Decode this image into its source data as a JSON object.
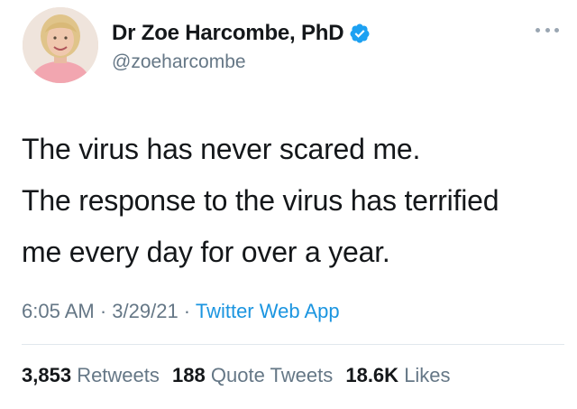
{
  "author": {
    "display_name": "Dr Zoe Harcombe, PhD",
    "handle": "@zoeharcombe",
    "verified": true
  },
  "tweet": {
    "lines": [
      "The virus has never scared me.",
      "The response to the virus has terrified",
      "me every day for over a year."
    ]
  },
  "meta": {
    "time": "6:05 AM",
    "separator": " · ",
    "date": "3/29/21",
    "source": "Twitter Web App"
  },
  "stats": {
    "retweets_count": "3,853",
    "retweets_label": "Retweets",
    "quotes_count": "188",
    "quotes_label": "Quote Tweets",
    "likes_count": "18.6K",
    "likes_label": "Likes"
  },
  "colors": {
    "verified_badge": "#1da1f2",
    "link": "#1b95e0",
    "secondary_text": "#657786"
  }
}
